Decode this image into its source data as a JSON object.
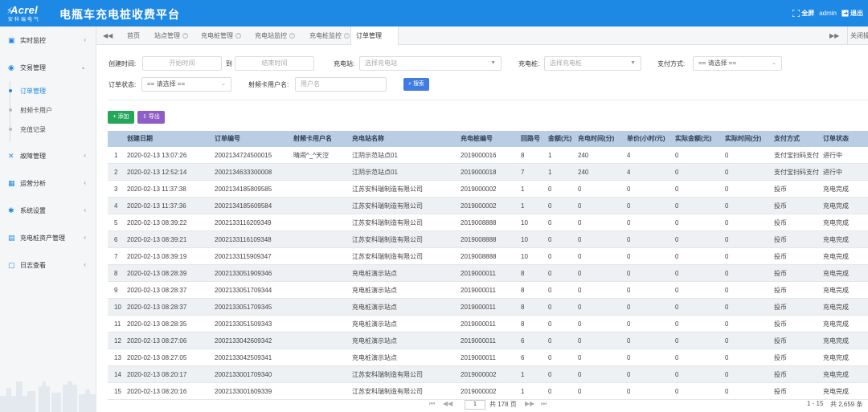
{
  "header": {
    "logo_main": "Acrel",
    "logo_sub": "安科瑞电气",
    "title": "电瓶车充电桩收费平台",
    "fullscreen_label": "全屏",
    "user": "admin",
    "logout_label": "退出",
    "bg_color": "#1e88e5"
  },
  "sidebar": {
    "items": [
      {
        "label": "实时监控",
        "icon": "monitor-icon"
      },
      {
        "label": "交易管理",
        "icon": "transaction-icon",
        "expanded": true,
        "children": [
          "订单管理",
          "射频卡用户",
          "充值记录"
        ],
        "active_child": 0
      },
      {
        "label": "故障管理",
        "icon": "fault-icon"
      },
      {
        "label": "运营分析",
        "icon": "analysis-icon"
      },
      {
        "label": "系统设置",
        "icon": "settings-icon"
      },
      {
        "label": "充电桩资产管理",
        "icon": "asset-icon"
      },
      {
        "label": "日志查看",
        "icon": "log-icon"
      }
    ]
  },
  "tabs": {
    "items": [
      "首页",
      "站点管理",
      "充电桩管理",
      "充电站监控",
      "充电桩监控",
      "订单管理"
    ],
    "active": 5,
    "close_others_label": "关闭操作"
  },
  "filters": {
    "create_time_label": "创建时间:",
    "start_placeholder": "开始时间",
    "to_label": "到",
    "end_placeholder": "结束时间",
    "station_label": "充电站:",
    "station_placeholder": "选择充电站",
    "pile_label": "充电桩:",
    "pile_placeholder": "选择充电桩",
    "pay_label": "支付方式:",
    "pay_value": "== 请选择 ==",
    "status_label": "订单状态:",
    "status_value": "== 请选择 ==",
    "card_label": "射频卡用户名:",
    "card_placeholder": "用户名",
    "search_label": "搜索"
  },
  "actions": {
    "add_label": "添加",
    "export_label": "导出"
  },
  "table": {
    "columns": [
      "创建日期",
      "订单编号",
      "射频卡用户名",
      "充电站名称",
      "充电桩编号",
      "回路号",
      "金额(元)",
      "充电时间(分)",
      "单价(小时/元)",
      "实际金额(元)",
      "实际时间(分)",
      "支付方式",
      "订单状态"
    ],
    "rows": [
      [
        "1",
        "2020-02-13 13:07:26",
        "2002134724500015",
        "晴闹^_^天涳",
        "江阴示范站点01",
        "2019000016",
        "8",
        "1",
        "240",
        "4",
        "0",
        "0",
        "支付宝扫码支付",
        "进行中"
      ],
      [
        "2",
        "2020-02-13 12:52:14",
        "2002134633300008",
        "",
        "江阴示范站点01",
        "2019000018",
        "7",
        "1",
        "240",
        "4",
        "0",
        "0",
        "支付宝扫码支付",
        "进行中"
      ],
      [
        "3",
        "2020-02-13 11:37:38",
        "2002134185809585",
        "",
        "江苏安科瑞制造有限公司",
        "2019000002",
        "1",
        "0",
        "0",
        "0",
        "0",
        "0",
        "投币",
        "充电完成"
      ],
      [
        "4",
        "2020-02-13 11:37:36",
        "2002134185609584",
        "",
        "江苏安科瑞制造有限公司",
        "2019000002",
        "1",
        "0",
        "0",
        "0",
        "0",
        "0",
        "投币",
        "充电完成"
      ],
      [
        "5",
        "2020-02-13 08:39:22",
        "2002133116209349",
        "",
        "江苏安科瑞制造有限公司",
        "2019008888",
        "10",
        "0",
        "0",
        "0",
        "0",
        "0",
        "投币",
        "充电完成"
      ],
      [
        "6",
        "2020-02-13 08:39:21",
        "2002133116109348",
        "",
        "江苏安科瑞制造有限公司",
        "2019008888",
        "10",
        "0",
        "0",
        "0",
        "0",
        "0",
        "投币",
        "充电完成"
      ],
      [
        "7",
        "2020-02-13 08:39:19",
        "2002133115909347",
        "",
        "江苏安科瑞制造有限公司",
        "2019008888",
        "10",
        "0",
        "0",
        "0",
        "0",
        "0",
        "投币",
        "充电完成"
      ],
      [
        "8",
        "2020-02-13 08:28:39",
        "2002133051909346",
        "",
        "充电桩演示站点",
        "2019000011",
        "8",
        "0",
        "0",
        "0",
        "0",
        "0",
        "投币",
        "充电完成"
      ],
      [
        "9",
        "2020-02-13 08:28:37",
        "2002133051709344",
        "",
        "充电桩演示站点",
        "2019000011",
        "8",
        "0",
        "0",
        "0",
        "0",
        "0",
        "投币",
        "充电完成"
      ],
      [
        "10",
        "2020-02-13 08:28:37",
        "2002133051709345",
        "",
        "充电桩演示站点",
        "2019000011",
        "8",
        "0",
        "0",
        "0",
        "0",
        "0",
        "投币",
        "充电完成"
      ],
      [
        "11",
        "2020-02-13 08:28:35",
        "2002133051509343",
        "",
        "充电桩演示站点",
        "2019000011",
        "8",
        "0",
        "0",
        "0",
        "0",
        "0",
        "投币",
        "充电完成"
      ],
      [
        "12",
        "2020-02-13 08:27:06",
        "2002133042609342",
        "",
        "充电桩演示站点",
        "2019000011",
        "6",
        "0",
        "0",
        "0",
        "0",
        "0",
        "投币",
        "充电完成"
      ],
      [
        "13",
        "2020-02-13 08:27:05",
        "2002133042509341",
        "",
        "充电桩演示站点",
        "2019000011",
        "6",
        "0",
        "0",
        "0",
        "0",
        "0",
        "投币",
        "充电完成"
      ],
      [
        "14",
        "2020-02-13 08:20:17",
        "2002133001709340",
        "",
        "江苏安科瑞制造有限公司",
        "2019000002",
        "1",
        "0",
        "0",
        "0",
        "0",
        "0",
        "投币",
        "充电完成"
      ],
      [
        "15",
        "2020-02-13 08:20:16",
        "2002133001609339",
        "",
        "江苏安科瑞制造有限公司",
        "2019000002",
        "1",
        "0",
        "0",
        "0",
        "0",
        "0",
        "投币",
        "充电完成"
      ]
    ]
  },
  "pager": {
    "page": "1",
    "total_pages_label": "共 178 页",
    "range_label": "1 - 15",
    "total_label": "共 2,659 条"
  }
}
